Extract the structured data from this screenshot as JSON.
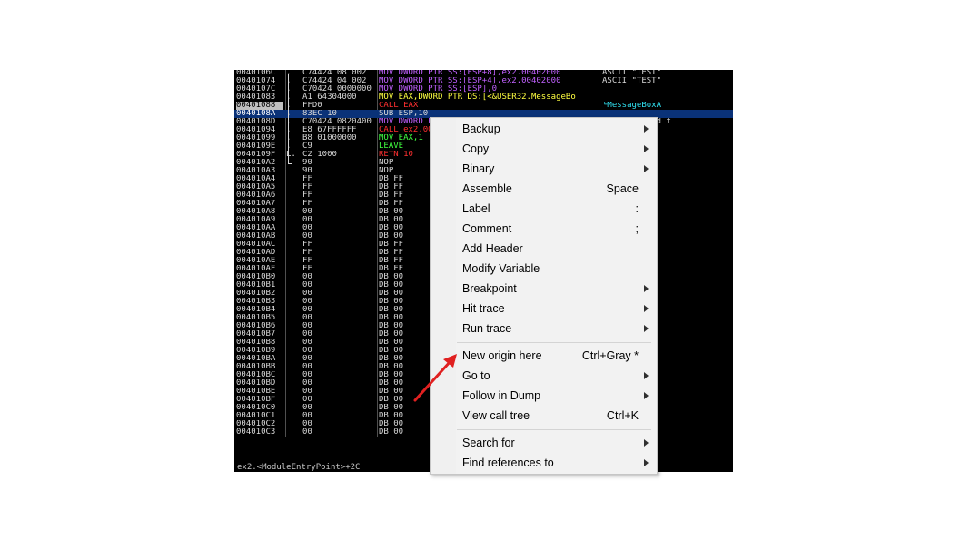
{
  "debugger": {
    "rows": [
      {
        "addr": "0040106C",
        "mark": ".",
        "hex": "C74424 08 002",
        "dis": "MOV DWORD PTR SS:[ESP+8],ex2.00402000",
        "dis_class": "c-mov",
        "cmt": "ASCII \"TEST\"",
        "cmt_class": "c-nop"
      },
      {
        "addr": "00401074",
        "mark": ".",
        "hex": "C74424 04 002",
        "dis": "MOV DWORD PTR SS:[ESP+4],ex2.00402000",
        "dis_class": "c-mov",
        "cmt": "ASCII \"TEST\"",
        "cmt_class": "c-nop"
      },
      {
        "addr": "0040107C",
        "mark": ".",
        "hex": "C70424 0000000",
        "dis": "MOV DWORD PTR SS:[ESP],0",
        "dis_class": "c-mov",
        "cmt": "",
        "cmt_class": "c-nop"
      },
      {
        "addr": "00401083",
        "mark": ".",
        "hex": "A1 64304000",
        "dis": "MOV EAX,DWORD PTR DS:[<&USER32.MessageBo",
        "dis_class": "c-yel",
        "cmt": "",
        "cmt_class": "c-nop"
      },
      {
        "addr": "00401088",
        "mark": ".",
        "hex": "FFD0",
        "dis": "CALL EAX",
        "dis_class": "c-call",
        "cmt": "└MessageBoxA",
        "cmt_class": "c-link",
        "state": "cur"
      },
      {
        "addr": "0040108A",
        "mark": ".",
        "hex": "83EC 10",
        "dis": "SUB ESP,10",
        "dis_class": "c-nop",
        "cmt": "",
        "cmt_class": "c-nop",
        "state": "sel"
      },
      {
        "addr": "0040108D",
        "mark": ".",
        "hex": "C70424 0820400",
        "dis": "MOV DWORD PTR SS:[ESP],ex2.00402008",
        "dis_class": "c-mov",
        "cmt": "s is printed t",
        "cmt_class": "c-nop"
      },
      {
        "addr": "00401094",
        "mark": ".",
        "hex": "E8 67FFFFFF",
        "dis": "CALL ex2.00401000",
        "dis_class": "c-call",
        "cmt": "",
        "cmt_class": "c-nop"
      },
      {
        "addr": "00401099",
        "mark": ".",
        "hex": "B8 01000000",
        "dis": "MOV EAX,1",
        "dis_class": "c-leave",
        "cmt": "",
        "cmt_class": "c-nop"
      },
      {
        "addr": "0040109E",
        "mark": ".",
        "hex": "C9",
        "dis": "LEAVE",
        "dis_class": "c-leave",
        "cmt": "",
        "cmt_class": "c-nop"
      },
      {
        "addr": "0040109F",
        "mark": "L.",
        "hex": "C2 1000",
        "dis": "RETN 10",
        "dis_class": "c-ret",
        "cmt": "",
        "cmt_class": "c-nop"
      },
      {
        "addr": "004010A2",
        "mark": "",
        "hex": "90",
        "dis": "NOP",
        "dis_class": "c-nop",
        "cmt": "",
        "cmt_class": "c-nop"
      },
      {
        "addr": "004010A3",
        "mark": "",
        "hex": "90",
        "dis": "NOP",
        "dis_class": "c-nop",
        "cmt": "",
        "cmt_class": "c-nop"
      },
      {
        "addr": "004010A4",
        "mark": "",
        "hex": "FF",
        "dis": "DB FF",
        "dis_class": "c-db",
        "cmt": "",
        "cmt_class": "c-nop"
      },
      {
        "addr": "004010A5",
        "mark": "",
        "hex": "FF",
        "dis": "DB FF",
        "dis_class": "c-db",
        "cmt": "",
        "cmt_class": "c-nop"
      },
      {
        "addr": "004010A6",
        "mark": "",
        "hex": "FF",
        "dis": "DB FF",
        "dis_class": "c-db",
        "cmt": "",
        "cmt_class": "c-nop"
      },
      {
        "addr": "004010A7",
        "mark": "",
        "hex": "FF",
        "dis": "DB FF",
        "dis_class": "c-db",
        "cmt": "",
        "cmt_class": "c-nop"
      },
      {
        "addr": "004010A8",
        "mark": "",
        "hex": "00",
        "dis": "DB 00",
        "dis_class": "c-db",
        "cmt": "",
        "cmt_class": "c-nop"
      },
      {
        "addr": "004010A9",
        "mark": "",
        "hex": "00",
        "dis": "DB 00",
        "dis_class": "c-db",
        "cmt": "",
        "cmt_class": "c-nop"
      },
      {
        "addr": "004010AA",
        "mark": "",
        "hex": "00",
        "dis": "DB 00",
        "dis_class": "c-db",
        "cmt": "",
        "cmt_class": "c-nop"
      },
      {
        "addr": "004010AB",
        "mark": "",
        "hex": "00",
        "dis": "DB 00",
        "dis_class": "c-db",
        "cmt": "",
        "cmt_class": "c-nop"
      },
      {
        "addr": "004010AC",
        "mark": "",
        "hex": "FF",
        "dis": "DB FF",
        "dis_class": "c-db",
        "cmt": "",
        "cmt_class": "c-nop"
      },
      {
        "addr": "004010AD",
        "mark": "",
        "hex": "FF",
        "dis": "DB FF",
        "dis_class": "c-db",
        "cmt": "",
        "cmt_class": "c-nop"
      },
      {
        "addr": "004010AE",
        "mark": "",
        "hex": "FF",
        "dis": "DB FF",
        "dis_class": "c-db",
        "cmt": "",
        "cmt_class": "c-nop"
      },
      {
        "addr": "004010AF",
        "mark": "",
        "hex": "FF",
        "dis": "DB FF",
        "dis_class": "c-db",
        "cmt": "",
        "cmt_class": "c-nop"
      },
      {
        "addr": "004010B0",
        "mark": "",
        "hex": "00",
        "dis": "DB 00",
        "dis_class": "c-db",
        "cmt": "",
        "cmt_class": "c-nop"
      },
      {
        "addr": "004010B1",
        "mark": "",
        "hex": "00",
        "dis": "DB 00",
        "dis_class": "c-db",
        "cmt": "",
        "cmt_class": "c-nop"
      },
      {
        "addr": "004010B2",
        "mark": "",
        "hex": "00",
        "dis": "DB 00",
        "dis_class": "c-db",
        "cmt": "",
        "cmt_class": "c-nop"
      },
      {
        "addr": "004010B3",
        "mark": "",
        "hex": "00",
        "dis": "DB 00",
        "dis_class": "c-db",
        "cmt": "",
        "cmt_class": "c-nop"
      },
      {
        "addr": "004010B4",
        "mark": "",
        "hex": "00",
        "dis": "DB 00",
        "dis_class": "c-db",
        "cmt": "",
        "cmt_class": "c-nop"
      },
      {
        "addr": "004010B5",
        "mark": "",
        "hex": "00",
        "dis": "DB 00",
        "dis_class": "c-db",
        "cmt": "",
        "cmt_class": "c-nop"
      },
      {
        "addr": "004010B6",
        "mark": "",
        "hex": "00",
        "dis": "DB 00",
        "dis_class": "c-db",
        "cmt": "",
        "cmt_class": "c-nop"
      },
      {
        "addr": "004010B7",
        "mark": "",
        "hex": "00",
        "dis": "DB 00",
        "dis_class": "c-db",
        "cmt": "",
        "cmt_class": "c-nop"
      },
      {
        "addr": "004010B8",
        "mark": "",
        "hex": "00",
        "dis": "DB 00",
        "dis_class": "c-db",
        "cmt": "",
        "cmt_class": "c-nop"
      },
      {
        "addr": "004010B9",
        "mark": "",
        "hex": "00",
        "dis": "DB 00",
        "dis_class": "c-db",
        "cmt": "",
        "cmt_class": "c-nop"
      },
      {
        "addr": "004010BA",
        "mark": "",
        "hex": "00",
        "dis": "DB 00",
        "dis_class": "c-db",
        "cmt": "",
        "cmt_class": "c-nop"
      },
      {
        "addr": "004010BB",
        "mark": "",
        "hex": "00",
        "dis": "DB 00",
        "dis_class": "c-db",
        "cmt": "",
        "cmt_class": "c-nop"
      },
      {
        "addr": "004010BC",
        "mark": "",
        "hex": "00",
        "dis": "DB 00",
        "dis_class": "c-db",
        "cmt": "",
        "cmt_class": "c-nop"
      },
      {
        "addr": "004010BD",
        "mark": "",
        "hex": "00",
        "dis": "DB 00",
        "dis_class": "c-db",
        "cmt": "",
        "cmt_class": "c-nop"
      },
      {
        "addr": "004010BE",
        "mark": "",
        "hex": "00",
        "dis": "DB 00",
        "dis_class": "c-db",
        "cmt": "",
        "cmt_class": "c-nop"
      },
      {
        "addr": "004010BF",
        "mark": "",
        "hex": "00",
        "dis": "DB 00",
        "dis_class": "c-db",
        "cmt": "",
        "cmt_class": "c-nop"
      },
      {
        "addr": "004010C0",
        "mark": "",
        "hex": "00",
        "dis": "DB 00",
        "dis_class": "c-db",
        "cmt": "",
        "cmt_class": "c-nop"
      },
      {
        "addr": "004010C1",
        "mark": "",
        "hex": "00",
        "dis": "DB 00",
        "dis_class": "c-db",
        "cmt": "",
        "cmt_class": "c-nop"
      },
      {
        "addr": "004010C2",
        "mark": "",
        "hex": "00",
        "dis": "DB 00",
        "dis_class": "c-db",
        "cmt": "",
        "cmt_class": "c-nop"
      },
      {
        "addr": "004010C3",
        "mark": "",
        "hex": "00",
        "dis": "DB 00",
        "dis_class": "c-db",
        "cmt": "",
        "cmt_class": "c-nop"
      }
    ],
    "info_text": "ex2.<ModuleEntryPoint>+2C"
  },
  "context_menu": {
    "items": [
      {
        "name": "backup",
        "label": "Backup",
        "shortcut": "",
        "submenu": true
      },
      {
        "name": "copy",
        "label": "Copy",
        "shortcut": "",
        "submenu": true
      },
      {
        "name": "binary",
        "label": "Binary",
        "shortcut": "",
        "submenu": true
      },
      {
        "name": "assemble",
        "label": "Assemble",
        "shortcut": "Space",
        "submenu": false
      },
      {
        "name": "label",
        "label": "Label",
        "shortcut": ":",
        "submenu": false
      },
      {
        "name": "comment",
        "label": "Comment",
        "shortcut": ";",
        "submenu": false
      },
      {
        "name": "add-header",
        "label": "Add Header",
        "shortcut": "",
        "submenu": false
      },
      {
        "name": "modify-variable",
        "label": "Modify Variable",
        "shortcut": "",
        "submenu": false
      },
      {
        "name": "breakpoint",
        "label": "Breakpoint",
        "shortcut": "",
        "submenu": true
      },
      {
        "name": "hit-trace",
        "label": "Hit trace",
        "shortcut": "",
        "submenu": true
      },
      {
        "name": "run-trace",
        "label": "Run trace",
        "shortcut": "",
        "submenu": true
      },
      {
        "name": "separator",
        "label": "",
        "shortcut": "",
        "submenu": false
      },
      {
        "name": "new-origin-here",
        "label": "New origin here",
        "shortcut": "Ctrl+Gray *",
        "submenu": false
      },
      {
        "name": "go-to",
        "label": "Go to",
        "shortcut": "",
        "submenu": true
      },
      {
        "name": "follow-in-dump",
        "label": "Follow in Dump",
        "shortcut": "",
        "submenu": true
      },
      {
        "name": "view-call-tree",
        "label": "View call tree",
        "shortcut": "Ctrl+K",
        "submenu": false
      },
      {
        "name": "separator",
        "label": "",
        "shortcut": "",
        "submenu": false
      },
      {
        "name": "search-for",
        "label": "Search for",
        "shortcut": "",
        "submenu": true
      },
      {
        "name": "find-references-to",
        "label": "Find references to",
        "shortcut": "",
        "submenu": true
      }
    ]
  },
  "annotation": {
    "icon": "red-arrow-icon",
    "color": "#e02020"
  }
}
